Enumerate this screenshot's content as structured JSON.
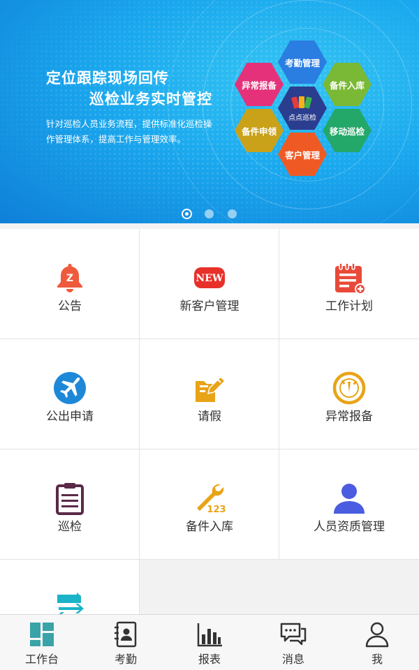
{
  "banner": {
    "headline_line1": "定位跟踪现场回传",
    "headline_line2": "巡检业务实时管控",
    "description": "针对巡检人员业务流程，提供标准化巡检操作管理体系，提高工作与管理效率。",
    "hexagons": {
      "top": "考勤管理",
      "upper_left": "异常报备",
      "upper_right": "备件入库",
      "center": "点点巡检",
      "lower_left": "备件申领",
      "lower_right": "移动巡检",
      "bottom": "客户管理"
    },
    "carousel_dots": 3,
    "active_dot": 1
  },
  "grid": {
    "items": [
      {
        "label": "公告",
        "icon": "bell-icon"
      },
      {
        "label": "新客户管理",
        "icon": "new-badge-icon"
      },
      {
        "label": "工作计划",
        "icon": "notepad-icon"
      },
      {
        "label": "公出申请",
        "icon": "airplane-icon"
      },
      {
        "label": "请假",
        "icon": "edit-folder-icon"
      },
      {
        "label": "异常报备",
        "icon": "gauge-icon"
      },
      {
        "label": "巡检",
        "icon": "clipboard-icon"
      },
      {
        "label": "备件入库",
        "icon": "wrench-icon"
      },
      {
        "label": "人员资质管理",
        "icon": "person-icon"
      },
      {
        "label": "",
        "icon": "transfer-icon"
      }
    ]
  },
  "tabbar": {
    "tabs": [
      {
        "label": "工作台",
        "icon": "dashboard-icon",
        "active": true
      },
      {
        "label": "考勤",
        "icon": "contacts-book-icon",
        "active": false
      },
      {
        "label": "报表",
        "icon": "bar-chart-icon",
        "active": false
      },
      {
        "label": "消息",
        "icon": "message-icon",
        "active": false
      },
      {
        "label": "我",
        "icon": "user-icon",
        "active": false
      }
    ]
  },
  "colors": {
    "accent": "#3aa3a8",
    "banner_blue": "#1aa8ee",
    "bell_red": "#f05a3c",
    "airplane_blue": "#1e88d8",
    "gold": "#e8a317",
    "purple": "#5a2a48",
    "person_blue": "#4a5ce0",
    "transfer_cyan": "#1bb3c8"
  }
}
